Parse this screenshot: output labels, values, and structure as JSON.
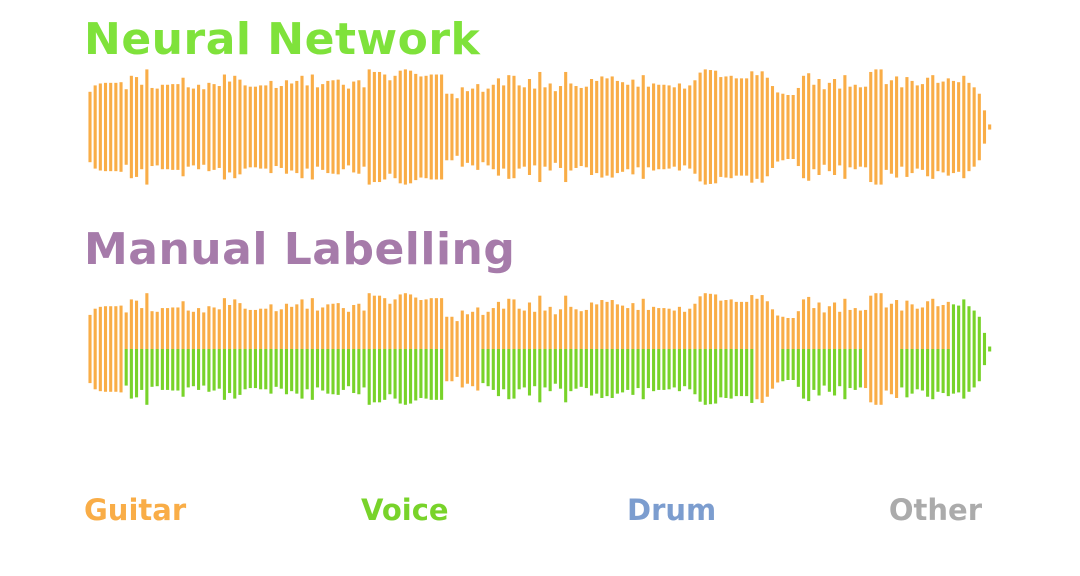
{
  "colors": {
    "guitar": "#F9AD47",
    "voice": "#78D32A",
    "drum": "#7C9DCF",
    "other": "#ABABAB",
    "title_nn": "#7FE23B",
    "title_ml": "#A67BAA"
  },
  "legend": {
    "guitar": "Guitar",
    "voice": "Voice",
    "drum": "Drum",
    "other": "Other"
  },
  "chart_data": [
    {
      "type": "waveform",
      "title": "Neural Network",
      "classes": [
        "Guitar",
        "Voice",
        "Drum",
        "Other"
      ],
      "amplitudes": [
        0.55,
        0.65,
        0.68,
        0.69,
        0.69,
        0.69,
        0.7,
        0.59,
        0.8,
        0.78,
        0.66,
        0.9,
        0.61,
        0.6,
        0.66,
        0.66,
        0.67,
        0.67,
        0.77,
        0.62,
        0.6,
        0.66,
        0.59,
        0.69,
        0.67,
        0.64,
        0.82,
        0.71,
        0.8,
        0.74,
        0.65,
        0.63,
        0.63,
        0.65,
        0.65,
        0.72,
        0.61,
        0.64,
        0.73,
        0.68,
        0.72,
        0.8,
        0.65,
        0.82,
        0.62,
        0.67,
        0.72,
        0.73,
        0.74,
        0.66,
        0.6,
        0.71,
        0.73,
        0.62,
        0.9,
        0.86,
        0.86,
        0.82,
        0.73,
        0.8,
        0.88,
        0.9,
        0.88,
        0.83,
        0.79,
        0.8,
        0.82,
        0.82,
        0.82,
        0.52,
        0.52,
        0.45,
        0.62,
        0.56,
        0.6,
        0.67,
        0.55,
        0.6,
        0.66,
        0.76,
        0.65,
        0.81,
        0.8,
        0.65,
        0.62,
        0.75,
        0.6,
        0.86,
        0.62,
        0.68,
        0.56,
        0.64,
        0.86,
        0.68,
        0.64,
        0.61,
        0.63,
        0.75,
        0.72,
        0.79,
        0.76,
        0.79,
        0.72,
        0.7,
        0.66,
        0.74,
        0.63,
        0.81,
        0.63,
        0.68,
        0.66,
        0.66,
        0.65,
        0.62,
        0.68,
        0.6,
        0.65,
        0.73,
        0.85,
        0.9,
        0.89,
        0.88,
        0.78,
        0.79,
        0.8,
        0.76,
        0.76,
        0.76,
        0.87,
        0.81,
        0.87,
        0.77,
        0.64,
        0.54,
        0.52,
        0.5,
        0.5,
        0.61,
        0.8,
        0.84,
        0.66,
        0.75,
        0.59,
        0.69,
        0.75,
        0.6,
        0.81,
        0.63,
        0.66,
        0.62,
        0.63,
        0.86,
        0.9,
        0.9,
        0.67,
        0.73,
        0.79,
        0.62,
        0.78,
        0.72,
        0.65,
        0.67,
        0.77,
        0.81,
        0.69,
        0.71,
        0.76,
        0.72,
        0.7,
        0.8,
        0.69,
        0.62,
        0.52,
        0.26,
        0.04
      ],
      "labels": "all Guitar"
    },
    {
      "type": "waveform",
      "title": "Manual Labelling",
      "classes": [
        "Guitar",
        "Voice",
        "Drum",
        "Other"
      ],
      "amplitudes": [
        0.55,
        0.65,
        0.68,
        0.69,
        0.69,
        0.69,
        0.7,
        0.59,
        0.8,
        0.78,
        0.66,
        0.9,
        0.61,
        0.6,
        0.66,
        0.66,
        0.67,
        0.67,
        0.77,
        0.62,
        0.6,
        0.66,
        0.59,
        0.69,
        0.67,
        0.64,
        0.82,
        0.71,
        0.8,
        0.74,
        0.65,
        0.63,
        0.63,
        0.65,
        0.65,
        0.72,
        0.61,
        0.64,
        0.73,
        0.68,
        0.72,
        0.8,
        0.65,
        0.82,
        0.62,
        0.67,
        0.72,
        0.73,
        0.74,
        0.66,
        0.6,
        0.71,
        0.73,
        0.62,
        0.9,
        0.86,
        0.86,
        0.82,
        0.73,
        0.8,
        0.88,
        0.9,
        0.88,
        0.83,
        0.79,
        0.8,
        0.82,
        0.82,
        0.82,
        0.52,
        0.52,
        0.45,
        0.62,
        0.56,
        0.6,
        0.67,
        0.55,
        0.6,
        0.66,
        0.76,
        0.65,
        0.81,
        0.8,
        0.65,
        0.62,
        0.75,
        0.6,
        0.86,
        0.62,
        0.68,
        0.56,
        0.64,
        0.86,
        0.68,
        0.64,
        0.61,
        0.63,
        0.75,
        0.72,
        0.79,
        0.76,
        0.79,
        0.72,
        0.7,
        0.66,
        0.74,
        0.63,
        0.81,
        0.63,
        0.68,
        0.66,
        0.66,
        0.65,
        0.62,
        0.68,
        0.6,
        0.65,
        0.73,
        0.85,
        0.9,
        0.89,
        0.88,
        0.78,
        0.79,
        0.8,
        0.76,
        0.76,
        0.76,
        0.87,
        0.81,
        0.87,
        0.77,
        0.64,
        0.54,
        0.52,
        0.5,
        0.5,
        0.61,
        0.8,
        0.84,
        0.66,
        0.75,
        0.59,
        0.69,
        0.75,
        0.6,
        0.81,
        0.63,
        0.66,
        0.62,
        0.63,
        0.86,
        0.9,
        0.9,
        0.67,
        0.73,
        0.79,
        0.62,
        0.78,
        0.72,
        0.65,
        0.67,
        0.77,
        0.81,
        0.69,
        0.71,
        0.76,
        0.72,
        0.7,
        0.8,
        0.69,
        0.62,
        0.52,
        0.26,
        0.04
      ],
      "lower_half_segments": [
        {
          "start": 0,
          "end": 6,
          "label": "Guitar"
        },
        {
          "start": 7,
          "end": 68,
          "label": "Voice"
        },
        {
          "start": 69,
          "end": 75,
          "label": "Guitar"
        },
        {
          "start": 76,
          "end": 128,
          "label": "Voice"
        },
        {
          "start": 129,
          "end": 133,
          "label": "Guitar"
        },
        {
          "start": 134,
          "end": 149,
          "label": "Voice"
        },
        {
          "start": 150,
          "end": 156,
          "label": "Guitar"
        },
        {
          "start": 157,
          "end": 168,
          "label": "Voice"
        }
      ],
      "upper_half_segments": [
        {
          "start": 0,
          "end": 166,
          "label": "Guitar"
        },
        {
          "start": 167,
          "end": 168,
          "label": "Voice"
        }
      ]
    }
  ]
}
